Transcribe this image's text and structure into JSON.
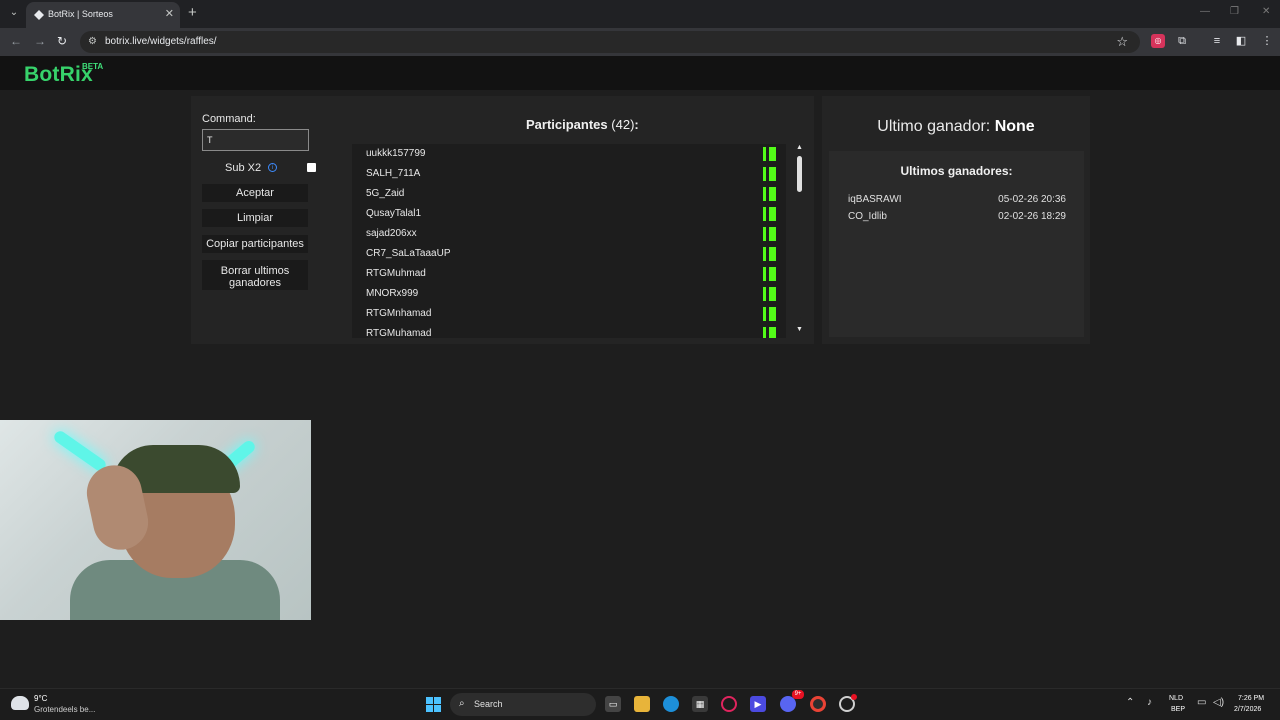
{
  "browser": {
    "tab_title": "BotRix | Sorteos",
    "tab_close": "✕",
    "new_tab": "+",
    "url": "botrix.live/widgets/raffles/",
    "window_controls": [
      "—",
      "❐",
      "✕"
    ]
  },
  "header": {
    "logo": "BotRix",
    "logo_badge": "BETA",
    "brand_color": "#37d26b"
  },
  "controls": {
    "command_label": "Command:",
    "command_value": "T",
    "sub_label": "Sub X2",
    "sub_checked": false,
    "buttons": {
      "accept": "Aceptar",
      "clear": "Limpiar",
      "copy": "Copiar participantes",
      "clear_winners": "Borrar ultimos ganadores"
    }
  },
  "participants": {
    "title": "Participantes",
    "count": "(42)",
    "colon": ":",
    "platform_icon": "kick-icon",
    "platform_color": "#53fc18",
    "list": [
      "uukkk157799",
      "SALH_711A",
      "5G_Zaid",
      "QusayTalal1",
      "sajad206xx",
      "CR7_SaLaTaaaUP",
      "RTGMuhmad",
      "MNORx999",
      "RTGMnhamad",
      "RTGMuhamad"
    ]
  },
  "winners": {
    "last_label": "Ultimo ganador:",
    "last_value": "None",
    "recent_title": "Ultimos ganadores:",
    "recent": [
      {
        "name": "iqBASRAWI",
        "date": "05-02-26 20:36"
      },
      {
        "name": "CO_Idlib",
        "date": "02-02-26 18:29"
      }
    ]
  },
  "taskbar": {
    "weather_temp": "9°C",
    "weather_desc": "Grotendeels be...",
    "search_label": "Search",
    "lang_primary": "NLD",
    "lang_secondary": "BEP",
    "time": "7:26 PM",
    "date": "2/7/2026",
    "chat_badge": "9+"
  }
}
